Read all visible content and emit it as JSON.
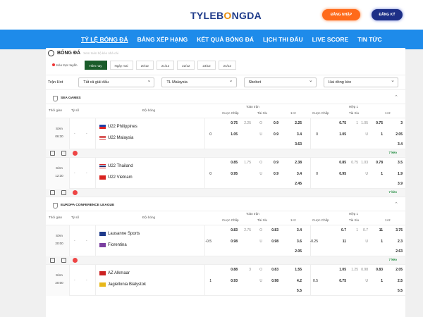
{
  "header": {
    "logo_prefix": "TYLEB",
    "logo_o": "O",
    "logo_suffix": "NGDA",
    "login": "ĐĂNG NHẬP",
    "register": "ĐĂNG KÝ"
  },
  "nav": [
    "TỶ LỆ BÓNG ĐÁ",
    "BẢNG XẾP HẠNG",
    "KẾT QUẢ BÓNG ĐÁ",
    "LỊCH THI ĐẤU",
    "LIVE SCORE",
    "TIN TỨC"
  ],
  "section": {
    "title": "BÓNG ĐÁ",
    "subtitle": "Xem toàn bộ kèo nhà cái"
  },
  "chips": [
    "Kèo trực tuyến",
    "Hôm nay",
    "Ngày mai",
    "20/12",
    "21/12",
    "22/12",
    "23/12",
    "24/12"
  ],
  "filters": {
    "label": "Trận Hot",
    "tournament": "Tất cả giải đấu",
    "country": "TL Malaysia",
    "bookmaker": "Sbobet",
    "odds_type": "Hai dòng kèo"
  },
  "table_head": {
    "time": "Thời gian",
    "score": "Tỷ số",
    "teams": "Đội bóng",
    "full": "Toàn trận",
    "half": "Hiệp 1",
    "handicap": "Cược Chấp",
    "ou": "Tài Xỉu",
    "x12": "1×2"
  },
  "leagues": [
    {
      "name": "SEA GAMES"
    },
    {
      "name": "EUROPA CONFERENCE LEAGUE"
    }
  ],
  "matches": [
    {
      "status": "Sớm",
      "time": "06:30",
      "home": "U22 Philippines",
      "away": "U22 Malaysia",
      "r1": {
        "h1": "",
        "h2": "0.75",
        "o1": "2.25",
        "o2": "O",
        "o3": "0.9",
        "x": "2.25",
        "hh1": "",
        "hh2": "0.75",
        "ho1": "1",
        "ho2": "1.05",
        "ho3": "0.75",
        "hx": "3"
      },
      "r2": {
        "h1": "0",
        "h2": "1.05",
        "o1": "",
        "o2": "U",
        "o3": "0.9",
        "x": "3.4",
        "hh1": "0",
        "hh2": "1.05",
        "ho1": "",
        "ho2": "U",
        "ho3": "1",
        "hx": "2.05"
      },
      "r3": {
        "x": "3.63",
        "hx": "3.4"
      },
      "more": "7 kèo"
    },
    {
      "status": "Sớm",
      "time": "12:30",
      "home": "U22 Thailand",
      "away": "U22 Vietnam",
      "r1": {
        "h1": "",
        "h2": "0.85",
        "o1": "1.75",
        "o2": "O",
        "o3": "0.9",
        "x": "2.38",
        "hh1": "",
        "hh2": "0.85",
        "ho1": "0.75",
        "ho2": "1.03",
        "ho3": "0.78",
        "hx": "3.5"
      },
      "r2": {
        "h1": "0",
        "h2": "0.95",
        "o1": "",
        "o2": "U",
        "o3": "0.9",
        "x": "3.4",
        "hh1": "0",
        "hh2": "0.95",
        "ho1": "",
        "ho2": "U",
        "ho3": "1",
        "hx": "1.9"
      },
      "r3": {
        "x": "2.45",
        "hx": "3.9"
      },
      "more": "7 kèo"
    },
    {
      "status": "Sớm",
      "time": "20:00",
      "home": "Lausanne Sports",
      "away": "Fiorentina",
      "r1": {
        "h1": "",
        "h2": "0.83",
        "o1": "2.75",
        "o2": "O",
        "o3": "0.83",
        "x": "3.4",
        "hh1": "",
        "hh2": "0.7",
        "ho1": "1",
        "ho2": "0.7",
        "ho3": "11",
        "hx": "3.75"
      },
      "r2": {
        "h1": "-0.5",
        "h2": "0.98",
        "o1": "",
        "o2": "U",
        "o3": "0.98",
        "x": "3.6",
        "hh1": "-0.25",
        "hh2": "11",
        "ho1": "",
        "ho2": "U",
        "ho3": "1",
        "hx": "2.3"
      },
      "r3": {
        "x": "2.05",
        "hx": "2.63"
      },
      "more": "7 kèo"
    },
    {
      "status": "Sớm",
      "time": "20:00",
      "home": "AZ Alkmaar",
      "away": "Jagiellonia Bialystok",
      "r1": {
        "h1": "",
        "h2": "0.88",
        "o1": "3",
        "o2": "O",
        "o3": "0.83",
        "x": "1.55",
        "hh1": "",
        "hh2": "1.05",
        "ho1": "1.25",
        "ho2": "0.98",
        "ho3": "0.83",
        "hx": "2.05"
      },
      "r2": {
        "h1": "1",
        "h2": "0.93",
        "o1": "",
        "o2": "U",
        "o3": "0.98",
        "x": "4.2",
        "hh1": "0.5",
        "hh2": "0.75",
        "ho1": "",
        "ho2": "U",
        "ho3": "1",
        "hx": "2.5"
      },
      "r3": {
        "x": "5.5",
        "hx": "5.5"
      },
      "more": ""
    }
  ]
}
